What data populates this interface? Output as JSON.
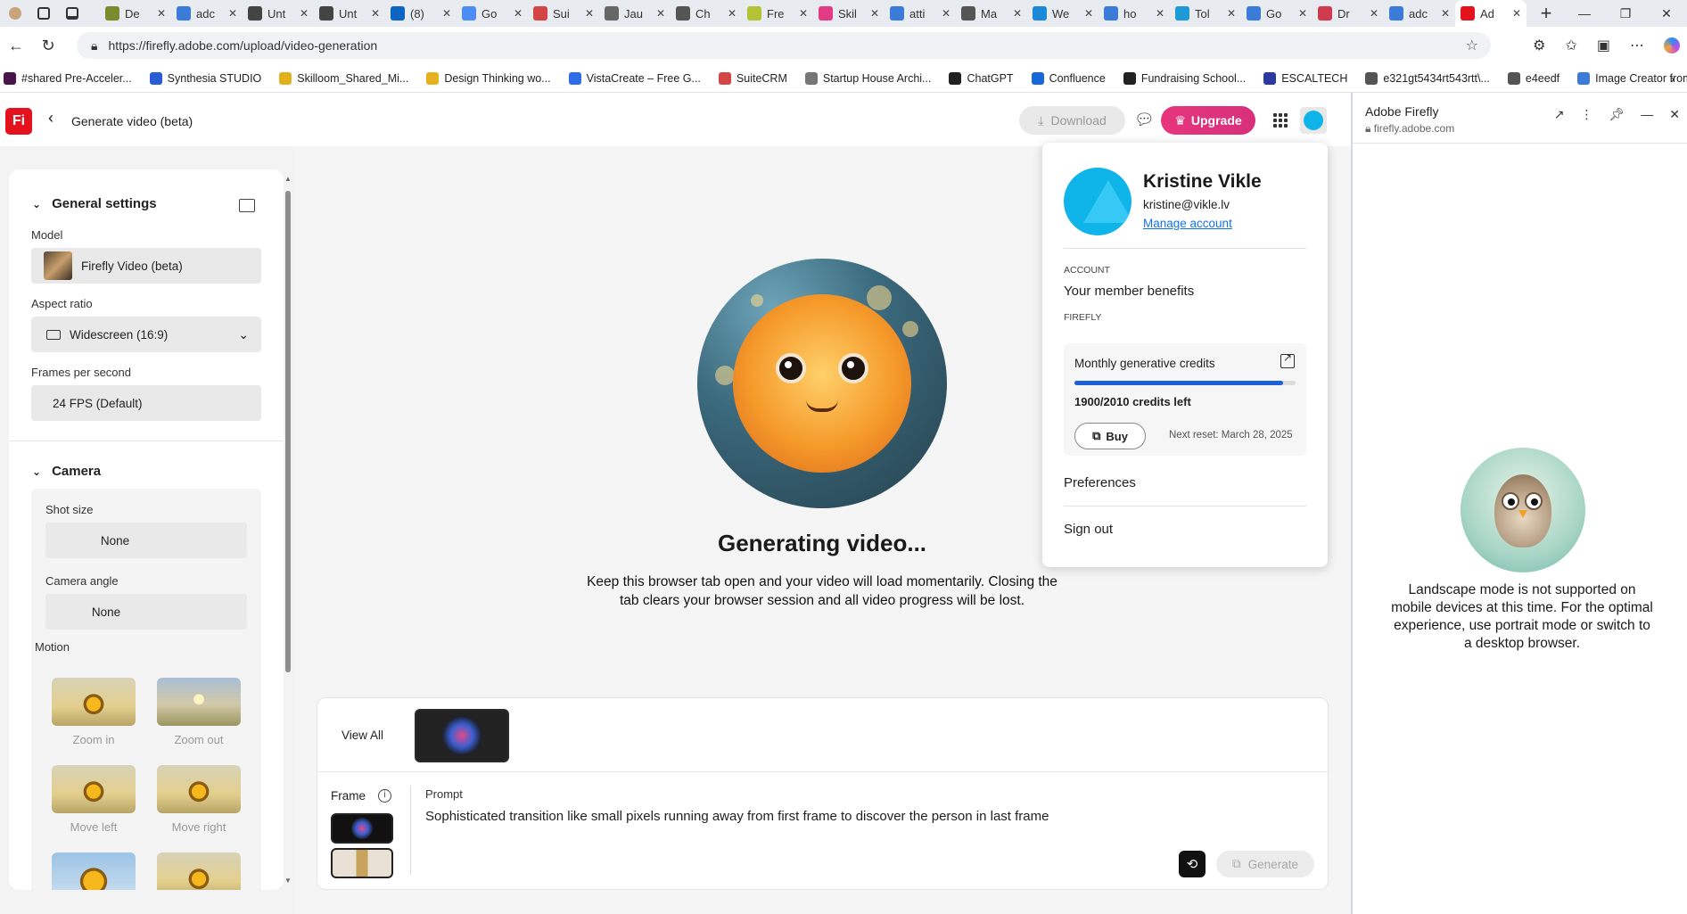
{
  "browser": {
    "tabs": [
      {
        "label": "De",
        "color": "#7a8b2e"
      },
      {
        "label": "adc",
        "color": "#3d7bd8"
      },
      {
        "label": "Unt",
        "color": "#444444"
      },
      {
        "label": "Unt",
        "color": "#444444"
      },
      {
        "label": "(8)",
        "color": "#0a66c2"
      },
      {
        "label": "Go",
        "color": "#4c8df5"
      },
      {
        "label": "Sui",
        "color": "#d64545"
      },
      {
        "label": "Jau",
        "color": "#666666"
      },
      {
        "label": "Ch",
        "color": "#555555"
      },
      {
        "label": "Fre",
        "color": "#b4c235"
      },
      {
        "label": "Skil",
        "color": "#e23b86"
      },
      {
        "label": "atti",
        "color": "#3d7bd8"
      },
      {
        "label": "Ma",
        "color": "#555555"
      },
      {
        "label": "We",
        "color": "#1b88d8"
      },
      {
        "label": "ho",
        "color": "#3d7bd8"
      },
      {
        "label": "Tol",
        "color": "#1e9ad6"
      },
      {
        "label": "Go",
        "color": "#3d7bd8"
      },
      {
        "label": "Dr",
        "color": "#d03a4f"
      },
      {
        "label": "adc",
        "color": "#3d7bd8"
      },
      {
        "label": "Ad",
        "color": "#e4121d",
        "active": true
      }
    ],
    "url": "https://firefly.adobe.com/upload/video-generation",
    "bookmarks": [
      {
        "label": "#shared Pre-Acceler...",
        "color": "#4a154b"
      },
      {
        "label": "Synthesia STUDIO",
        "color": "#2b5cd7"
      },
      {
        "label": "Skilloom_Shared_Mi...",
        "color": "#e3b11d"
      },
      {
        "label": "Design Thinking wo...",
        "color": "#e3b11d"
      },
      {
        "label": "VistaCreate – Free G...",
        "color": "#2e6de6"
      },
      {
        "label": "SuiteCRM",
        "color": "#d64545"
      },
      {
        "label": "Startup House Archi...",
        "color": "#777777"
      },
      {
        "label": "ChatGPT",
        "color": "#222222"
      },
      {
        "label": "Confluence",
        "color": "#1868db"
      },
      {
        "label": "Fundraising School...",
        "color": "#222222"
      },
      {
        "label": "ESCALTECH",
        "color": "#2b3aa0"
      },
      {
        "label": "e321gt5434rt543rtt\\...",
        "color": "#555555"
      },
      {
        "label": "e4eedf",
        "color": "#555555"
      },
      {
        "label": "Image Creator from...",
        "color": "#3d7bd8"
      }
    ]
  },
  "app": {
    "logo": "Fi",
    "title": "Generate video (beta)",
    "download_label": "Download",
    "upgrade_label": "Upgrade"
  },
  "settings": {
    "general_heading": "General settings",
    "model_label": "Model",
    "model_value": "Firefly Video (beta)",
    "aspect_label": "Aspect ratio",
    "aspect_value": "Widescreen (16:9)",
    "fps_label": "Frames per second",
    "fps_value": "24 FPS (Default)",
    "camera_heading": "Camera",
    "shot_label": "Shot size",
    "shot_value": "None",
    "angle_label": "Camera angle",
    "angle_value": "None",
    "motion_label": "Motion",
    "motions": [
      "Zoom in",
      "Zoom out",
      "Move left",
      "Move right"
    ]
  },
  "main": {
    "generating_title": "Generating video...",
    "generating_desc": "Keep this browser tab open and your video will load momentarily. Closing the tab clears your browser session and all video progress will be lost.",
    "view_all": "View All",
    "frame_label": "Frame",
    "prompt_label": "Prompt",
    "prompt_text": "Sophisticated transition like small pixels running away from first frame to discover the person in last frame",
    "generate_label": "Generate"
  },
  "account": {
    "name": "Kristine Vikle",
    "email": "kristine@vikle.lv",
    "manage_label": "Manage account",
    "account_caption": "ACCOUNT",
    "member_benefits": "Your member benefits",
    "firefly_caption": "FIREFLY",
    "credits_title": "Monthly generative credits",
    "credits_left": "1900/2010 credits left",
    "credits_fraction": 0.945,
    "buy_label": "Buy",
    "next_reset": "Next reset: March 28, 2025",
    "preferences": "Preferences",
    "sign_out": "Sign out"
  },
  "sidepanel": {
    "title": "Adobe Firefly",
    "url": "firefly.adobe.com",
    "message": "Landscape mode is not supported on mobile devices at this time. For the optimal experience, use portrait mode or switch to a desktop browser."
  }
}
